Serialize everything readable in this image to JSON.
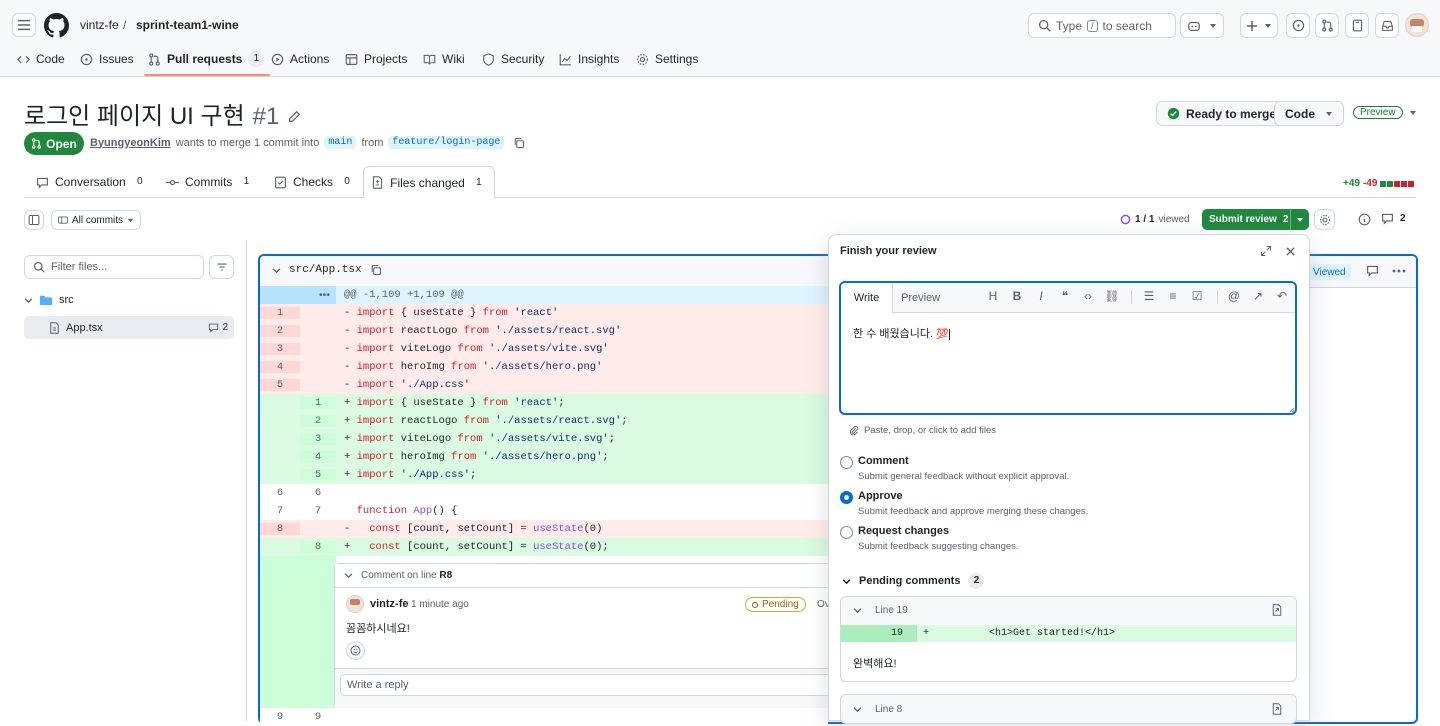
{
  "header": {
    "owner": "vintz-fe",
    "separator": "/",
    "repo": "sprint-team1-wine",
    "search": {
      "prefix": "Type",
      "key": "/",
      "suffix": "to search"
    }
  },
  "repo_nav": [
    {
      "label": "Code",
      "icon": "code-icon"
    },
    {
      "label": "Issues",
      "icon": "issue-icon"
    },
    {
      "label": "Pull requests",
      "icon": "pull-request-icon",
      "count": "1",
      "active": true
    },
    {
      "label": "Actions",
      "icon": "play-icon"
    },
    {
      "label": "Projects",
      "icon": "table-icon"
    },
    {
      "label": "Wiki",
      "icon": "book-icon"
    },
    {
      "label": "Security",
      "icon": "shield-icon"
    },
    {
      "label": "Insights",
      "icon": "graph-icon"
    },
    {
      "label": "Settings",
      "icon": "gear-icon"
    }
  ],
  "pr": {
    "title": "로그인 페이지 UI 구현",
    "number": "#1",
    "state": "Open",
    "author": "ByungyeonKim",
    "merge_text_1": "wants to merge 1 commit into",
    "base": "main",
    "merge_text_2": "from",
    "head": "feature/login-page",
    "ready_label": "Ready to merge",
    "code_label": "Code",
    "preview_label": "Preview",
    "diffstat_add": "+49",
    "diffstat_del": "-49"
  },
  "pr_tabs": [
    {
      "label": "Conversation",
      "count": "0"
    },
    {
      "label": "Commits",
      "count": "1"
    },
    {
      "label": "Checks",
      "count": "0"
    },
    {
      "label": "Files changed",
      "count": "1"
    }
  ],
  "toolbar": {
    "all_commits": "All commits",
    "viewed": "1 / 1",
    "viewed_suffix": "viewed",
    "submit_review": "Submit review",
    "submit_count": "2",
    "comments_count": "2"
  },
  "file_tree": {
    "filter_placeholder": "Filter files...",
    "folder": "src",
    "file": "App.tsx",
    "file_comments": "2"
  },
  "diff": {
    "path": "src/App.tsx",
    "viewed_label": "Viewed",
    "hunk": "@@ -1,109 +1,109 @@",
    "comment_header_prefix": "Comment on line",
    "comment_header_line": "R8",
    "comment_author": "vintz-fe",
    "comment_time": "1 minute ago",
    "comment_status": "Pending",
    "comment_status_extra": "Ov",
    "comment_body": "꼼꼼하시네요!",
    "reply_placeholder": "Write a reply",
    "tail_old": "9",
    "tail_new": "9"
  },
  "review": {
    "title": "Finish your review",
    "write_tab": "Write",
    "preview_tab": "Preview",
    "body_text": "한 수 배웠습니다. ",
    "body_emoji": "💯",
    "attach_hint": "Paste, drop, or click to add files",
    "options": [
      {
        "label": "Comment",
        "desc": "Submit general feedback without explicit approval.",
        "selected": false
      },
      {
        "label": "Approve",
        "desc": "Submit feedback and approve merging these changes.",
        "selected": true
      },
      {
        "label": "Request changes",
        "desc": "Submit feedback suggesting changes.",
        "selected": false
      }
    ],
    "pending_label": "Pending comments",
    "pending_count": "2",
    "pending": [
      {
        "line_label": "Line 19",
        "line_no": "19",
        "sign": "+",
        "code": "<h1>Get started!</h1>",
        "body": "완벽해요!"
      },
      {
        "line_label": "Line 8"
      }
    ]
  }
}
